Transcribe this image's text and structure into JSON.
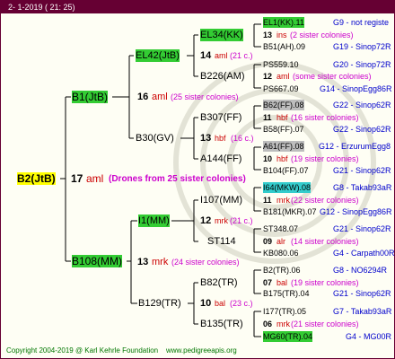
{
  "header": {
    "date": "2-   1-2019  ( 21:  25)"
  },
  "root": {
    "label": "B2(JtB)",
    "gen": "17",
    "mark": "aml",
    "note": "(Drones from 25 sister colonies)"
  },
  "left": {
    "upper": "B1(JtB)",
    "lower": "B108(MM)"
  },
  "mid": {
    "b1": {
      "gen": "16",
      "mark": "aml",
      "note": "(25 sister colonies)"
    },
    "b108": {
      "gen": "13",
      "mark": "mrk",
      "note": "(24 sister colonies)"
    }
  },
  "nodes": {
    "el42": "EL42(JtB)",
    "b30": "B30(GV)",
    "i1": "I1(MM)",
    "b129": "B129(TR)",
    "el34": "EL34(KK)",
    "b226": "B226(AM)",
    "b307": "B307(FF)",
    "a144": "A144(FF)",
    "i107": "I107(MM)",
    "st114": "ST114",
    "b82": "B82(TR)",
    "b135": "B135(TR)"
  },
  "third": {
    "el34": {
      "gen": "14",
      "mark": "aml",
      "note": "(21 c.)"
    },
    "b226": {
      "gen": "12",
      "mark": "aml",
      "note": "(some sister colonies)"
    },
    "b307": {
      "gen": "11",
      "mark": "hbf",
      "note": "(16 sister colonies)"
    },
    "a144": {
      "gen": "10",
      "mark": "hbf",
      "note": "(19 sister colonies)"
    },
    "b30": {
      "gen": "13",
      "mark": "hbf",
      "note": "(16 c.)"
    },
    "i107": {
      "gen": "11",
      "mark": "mrk",
      "note": "(22 sister colonies)"
    },
    "st114": {
      "gen": "09",
      "mark": "alr",
      "note": "(14 sister colonies)"
    },
    "i1": {
      "gen": "12",
      "mark": "mrk",
      "note": "(21 c.)"
    },
    "b82": {
      "gen": "07",
      "mark": "bal",
      "note": "(19 sister colonies)"
    },
    "b135": {
      "gen": "06",
      "mark": "mrk",
      "note": "(21 sister colonies)"
    },
    "b129": {
      "gen": "10",
      "mark": "bal",
      "note": "(23 c.)"
    },
    "el34b": {
      "gen": "13",
      "mark": "ins",
      "note": "(2 sister colonies)"
    }
  },
  "leaves": [
    {
      "name": "EL1(KK).11",
      "code": "G9 - not registe"
    },
    {
      "name": "B51(AH).09",
      "code": "G19 - Sinop72R"
    },
    {
      "name": "PS559.10",
      "code": "G20 - Sinop72R"
    },
    {
      "name": "PS667.09",
      "code": "G14 - SinopEgg86R"
    },
    {
      "name": "B62(FF).08",
      "code": "G22 - Sinop62R"
    },
    {
      "name": "B58(FF).07",
      "code": "G22 - Sinop62R"
    },
    {
      "name": "A61(FF).08",
      "code": "G12 - ErzurumEgg8"
    },
    {
      "name": "B104(FF).07",
      "code": "G21 - Sinop62R"
    },
    {
      "name": "I64(MKW).08",
      "code": "G8 - Takab93aR"
    },
    {
      "name": "B181(MKR).07",
      "code": "G12 - SinopEgg86R"
    },
    {
      "name": "ST348.07",
      "code": "G21 - Sinop62R"
    },
    {
      "name": "KB080.06",
      "code": "G4 - Carpath00R"
    },
    {
      "name": "B2(TR).06",
      "code": "G8 - NO6294R"
    },
    {
      "name": "B175(TR).04",
      "code": "G21 - Sinop62R"
    },
    {
      "name": "I177(TR).05",
      "code": "G7 - Takab93aR"
    },
    {
      "name": "MG60(TR).04",
      "code": "G4 - MG00R"
    }
  ],
  "footer": "Copyright 2004-2019 @ Karl Kehrle Foundation    www.pedigreeapis.org"
}
